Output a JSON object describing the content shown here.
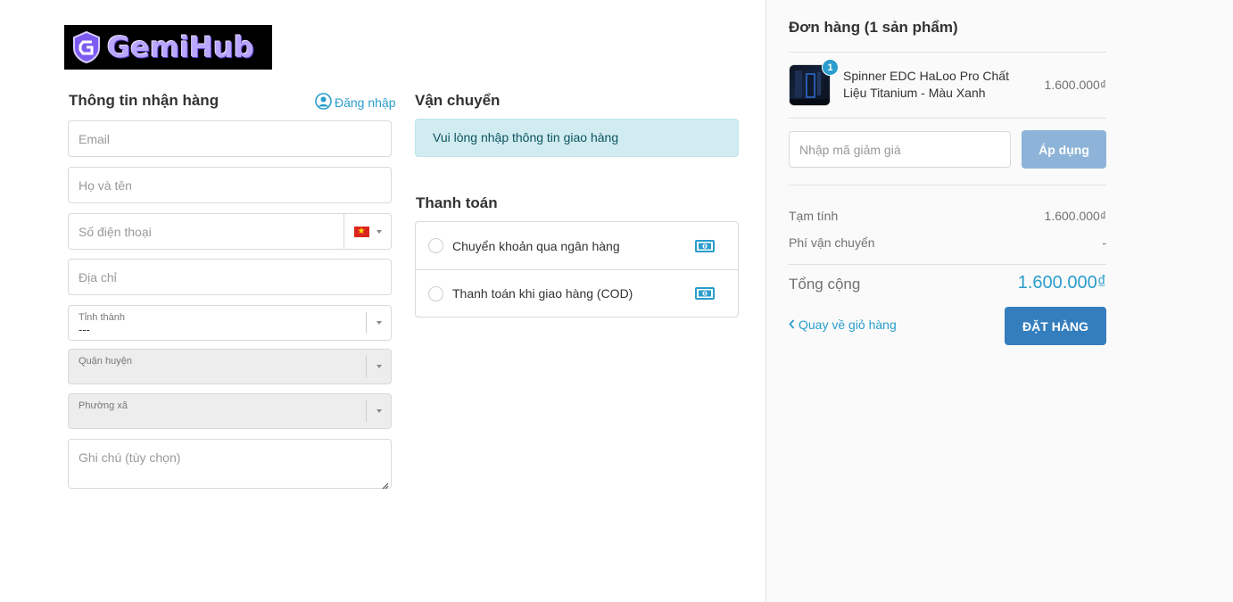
{
  "brand": {
    "logo_text": "GemiHub"
  },
  "customer": {
    "title": "Thông tin nhận hàng",
    "login_label": "Đăng nhập",
    "email_placeholder": "Email",
    "name_placeholder": "Họ và tên",
    "phone_placeholder": "Số điện thoại",
    "address_placeholder": "Địa chỉ",
    "province": {
      "label": "Tỉnh thành",
      "value": "---"
    },
    "district": {
      "label": "Quận huyện",
      "value": ""
    },
    "ward": {
      "label": "Phường xã",
      "value": ""
    },
    "note_placeholder": "Ghi chú (tùy chọn)"
  },
  "shipping": {
    "title": "Vận chuyển",
    "notice": "Vui lòng nhập thông tin giao hàng"
  },
  "payment": {
    "title": "Thanh toán",
    "methods": [
      {
        "label": "Chuyển khoản qua ngân hàng",
        "icon": "cash-icon"
      },
      {
        "label": "Thanh toán khi giao hàng (COD)",
        "icon": "cash-icon"
      }
    ]
  },
  "order": {
    "title": "Đơn hàng (1 sản phẩm)",
    "items": [
      {
        "name": "Spinner EDC HaLoo Pro Chất Liệu Titanium - Màu Xanh",
        "price": "1.600.000₫",
        "qty": "1"
      }
    ],
    "discount_placeholder": "Nhập mã giảm giá",
    "apply_label": "Áp dụng",
    "subtotal_label": "Tạm tính",
    "subtotal_value": "1.600.000₫",
    "shipping_fee_label": "Phí vận chuyển",
    "shipping_fee_value": "-",
    "total_label": "Tổng cộng",
    "total_value": "1.600.000₫",
    "back_label": "Quay về giỏ hàng",
    "submit_label": "ĐẶT HÀNG"
  },
  "colors": {
    "accent": "#2a9dcc",
    "submit": "#357ebd",
    "apply": "#8db4d8",
    "notice_bg": "#d1ecf1"
  }
}
